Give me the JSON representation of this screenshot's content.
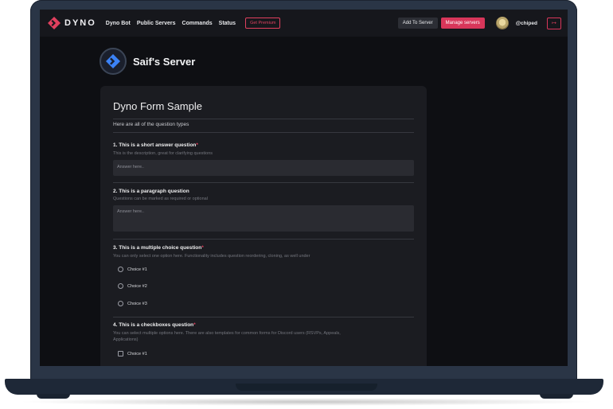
{
  "nav": {
    "logo_text": "DYNO",
    "links": [
      "Dyno Bot",
      "Public Servers",
      "Commands",
      "Status"
    ],
    "premium_label": "Get Premium",
    "add_label": "Add To Server",
    "manage_label": "Manage servers",
    "username": "@chiped",
    "logout_icon": "logout-icon"
  },
  "server": {
    "name": "Saif's Server",
    "icon": "dyno-logo-icon"
  },
  "form": {
    "title": "Dyno Form Sample",
    "description": "Here are all of the question types",
    "questions": [
      {
        "title": "1. This is a short answer question",
        "required_mark": "*",
        "subtitle": "This is the description, great for clarifying questions",
        "placeholder": "Answer here.."
      },
      {
        "title": "2. This is a paragraph question",
        "subtitle": "Questions can be marked as required or optional",
        "placeholder": "Answer here.."
      },
      {
        "title": "3. This is a multiple choice question",
        "required_mark": "*",
        "subtitle": "You can only select one option here. Functionality includes question reordering, cloning, as well under",
        "choices": [
          "Choice #1",
          "Choice #2",
          "Choice #3"
        ]
      },
      {
        "title": "4. This is a checkboxes question",
        "required_mark": "*",
        "subtitle": "You can select multiple options here. There are also templates for common forms for Discord users (RSVPs, Appeals,",
        "subtitle2": "Applications)",
        "choices": [
          "Choice #1"
        ]
      }
    ]
  },
  "colors": {
    "accent": "#d8365a",
    "background": "#0e0f13",
    "card": "#1b1c21",
    "logo": "#e0405e"
  }
}
